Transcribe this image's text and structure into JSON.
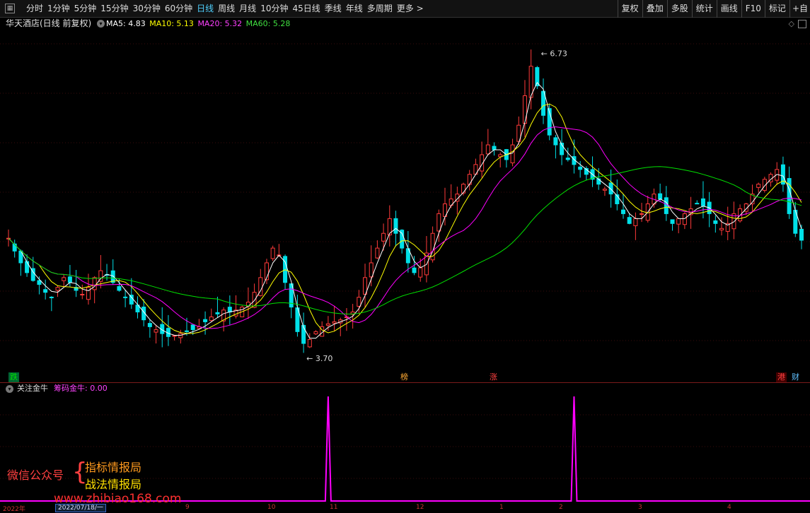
{
  "toolbar": {
    "tabs": [
      {
        "label": "分时"
      },
      {
        "label": "1分钟"
      },
      {
        "label": "5分钟"
      },
      {
        "label": "15分钟"
      },
      {
        "label": "30分钟"
      },
      {
        "label": "60分钟"
      },
      {
        "label": "日线"
      },
      {
        "label": "周线"
      },
      {
        "label": "月线"
      },
      {
        "label": "10分钟"
      },
      {
        "label": "45日线"
      },
      {
        "label": "季线"
      },
      {
        "label": "年线"
      },
      {
        "label": "多周期"
      },
      {
        "label": "更多 >"
      }
    ],
    "active_tab": "日线",
    "right_tools": [
      {
        "label": "复权"
      },
      {
        "label": "叠加"
      },
      {
        "label": "多股"
      },
      {
        "label": "统计"
      },
      {
        "label": "画线"
      },
      {
        "label": "F10"
      },
      {
        "label": "标记"
      },
      {
        "label": "+自"
      }
    ]
  },
  "stock": {
    "title": "华天酒店(日线 前复权)",
    "ma5": "MA5: 4.83",
    "ma10": "MA10: 5.13",
    "ma20": "MA20: 5.32",
    "ma60": "MA60: 5.28",
    "high_label": "6.73",
    "low_label": "3.70"
  },
  "badges": {
    "die": "跌",
    "bang": "榜",
    "zhang": "涨",
    "gang": "港",
    "cai": "财"
  },
  "sub_panel": {
    "name": "关注金牛",
    "indicator": "筹码金牛: 0.00"
  },
  "watermark": {
    "wechat": "微信公众号",
    "line1": "指标情报局",
    "line2": "战法情报局",
    "url": "www.zhibiao168.com"
  },
  "xaxis": {
    "year": "2022年",
    "date": "2022/07/18/一",
    "months": [
      "9",
      "10",
      "11",
      "12",
      "1",
      "2",
      "3",
      "4"
    ]
  },
  "colors": {
    "up": "#ff3a3a",
    "down": "#00e0e8",
    "ma5": "#ffffff",
    "ma10": "#ffff00",
    "ma20": "#ff00ff",
    "ma60": "#00e000",
    "signal": "#ff00ff"
  },
  "chart_data": {
    "type": "candlestick",
    "price_range": [
      3.5,
      6.9
    ],
    "annotated_high": 6.73,
    "annotated_low": 3.7,
    "close_series": [
      4.85,
      4.72,
      4.6,
      4.5,
      4.42,
      4.38,
      4.3,
      4.25,
      4.35,
      4.45,
      4.4,
      4.32,
      4.28,
      4.35,
      4.45,
      4.52,
      4.48,
      4.4,
      4.32,
      4.25,
      4.18,
      4.1,
      4.02,
      3.95,
      3.92,
      3.88,
      3.85,
      3.86,
      3.88,
      3.9,
      3.92,
      3.95,
      4.0,
      4.05,
      4.08,
      4.12,
      4.1,
      4.12,
      4.15,
      4.2,
      4.3,
      4.45,
      4.6,
      4.75,
      4.68,
      4.4,
      4.15,
      3.9,
      3.78,
      3.82,
      3.9,
      3.95,
      3.98,
      4.0,
      4.02,
      4.05,
      4.1,
      4.25,
      4.45,
      4.6,
      4.75,
      4.9,
      5.05,
      4.9,
      4.75,
      4.6,
      4.5,
      4.55,
      4.7,
      4.9,
      5.1,
      5.2,
      5.25,
      5.3,
      5.4,
      5.5,
      5.6,
      5.7,
      5.8,
      5.75,
      5.7,
      5.65,
      5.8,
      6.0,
      6.3,
      6.6,
      6.4,
      6.1,
      5.9,
      5.8,
      5.7,
      5.65,
      5.6,
      5.55,
      5.5,
      5.45,
      5.4,
      5.35,
      5.3,
      5.2,
      5.1,
      5.0,
      5.05,
      5.1,
      5.2,
      5.3,
      5.25,
      5.1,
      5.0,
      5.05,
      5.1,
      5.15,
      5.2,
      5.18,
      5.1,
      5.0,
      4.95,
      5.0,
      5.1,
      5.15,
      5.2,
      5.3,
      5.4,
      5.45,
      5.5,
      5.55,
      5.4,
      5.1,
      4.9,
      4.83
    ],
    "signal_series": [
      {
        "index": 52,
        "value": 1
      },
      {
        "index": 92,
        "value": 1
      }
    ]
  }
}
